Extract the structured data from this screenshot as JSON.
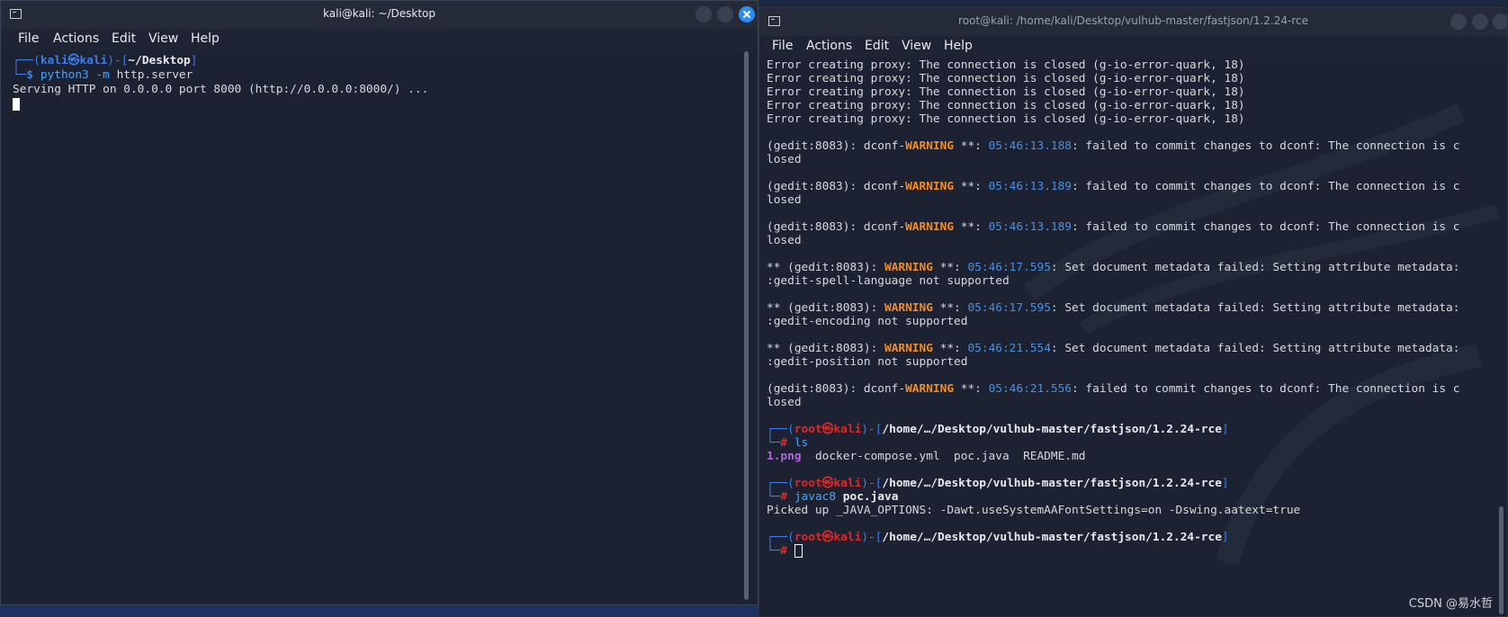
{
  "left_window": {
    "title": "kali@kali: ~/Desktop",
    "menu": [
      "File",
      "Actions",
      "Edit",
      "View",
      "Help"
    ],
    "prompt": {
      "corner_top": "┌──(",
      "user": "kali",
      "at": "㉿",
      "host": "kali",
      "mid": ")-[",
      "path": "~/Desktop",
      "end": "]",
      "corner_bottom": "└─",
      "dollar": "$ "
    },
    "command": {
      "prog": "python3 -m ",
      "rest": "http.server"
    },
    "output": "Serving HTTP on 0.0.0.0 port 8000 (http://0.0.0.0:8000/) ..."
  },
  "right_window": {
    "title": "root@kali: /home/kali/Desktop/vulhub-master/fastjson/1.2.24-rce",
    "menu": [
      "File",
      "Actions",
      "Edit",
      "View",
      "Help"
    ],
    "proxy_errors": [
      "Error creating proxy: The connection is closed (g-io-error-quark, 18)",
      "Error creating proxy: The connection is closed (g-io-error-quark, 18)",
      "Error creating proxy: The connection is closed (g-io-error-quark, 18)",
      "Error creating proxy: The connection is closed (g-io-error-quark, 18)",
      "Error creating proxy: The connection is closed (g-io-error-quark, 18)"
    ],
    "warnings": [
      {
        "pre": "(gedit:8083): dconf-",
        "tag": "WARNING",
        "mid": " **: ",
        "ts": "05:46:13.188",
        "msg": ": failed to commit changes to dconf: The connection is c",
        "cont": "losed"
      },
      {
        "pre": "(gedit:8083): dconf-",
        "tag": "WARNING",
        "mid": " **: ",
        "ts": "05:46:13.189",
        "msg": ": failed to commit changes to dconf: The connection is c",
        "cont": "losed"
      },
      {
        "pre": "(gedit:8083): dconf-",
        "tag": "WARNING",
        "mid": " **: ",
        "ts": "05:46:13.189",
        "msg": ": failed to commit changes to dconf: The connection is c",
        "cont": "losed"
      },
      {
        "pre": "** (gedit:8083): ",
        "tag": "WARNING",
        "mid": " **: ",
        "ts": "05:46:17.595",
        "msg": ": Set document metadata failed: Setting attribute metadata:",
        "cont": ":gedit-spell-language not supported"
      },
      {
        "pre": "** (gedit:8083): ",
        "tag": "WARNING",
        "mid": " **: ",
        "ts": "05:46:17.595",
        "msg": ": Set document metadata failed: Setting attribute metadata:",
        "cont": ":gedit-encoding not supported"
      },
      {
        "pre": "** (gedit:8083): ",
        "tag": "WARNING",
        "mid": " **: ",
        "ts": "05:46:21.554",
        "msg": ": Set document metadata failed: Setting attribute metadata:",
        "cont": ":gedit-position not supported"
      },
      {
        "pre": "(gedit:8083): dconf-",
        "tag": "WARNING",
        "mid": " **: ",
        "ts": "05:46:21.556",
        "msg": ": failed to commit changes to dconf: The connection is c",
        "cont": "losed"
      }
    ],
    "prompt": {
      "corner_top": "┌──(",
      "user": "root",
      "at": "㉿",
      "host": "kali",
      "mid": ")-[",
      "path": "/home/…/Desktop/vulhub-master/fastjson/1.2.24-rce",
      "end": "]",
      "corner_bottom": "└─",
      "hash": "# "
    },
    "cmd1": "ls",
    "ls_output": {
      "png": "1.png",
      "rest": "  docker-compose.yml  poc.java  README.md"
    },
    "cmd2": {
      "prog": "javac8 ",
      "arg": "poc.java"
    },
    "java_output": "Picked up _JAVA_OPTIONS: -Dawt.useSystemAAFontSettings=on -Dswing.aatext=true"
  },
  "watermark": "CSDN @易水哲",
  "colors": {
    "terminal_bg": "#1c2232",
    "prompt_blue": "#3f7ee8",
    "root_red": "#e02828",
    "warning_orange": "#f28c28",
    "close_button": "#2d8cf0"
  }
}
